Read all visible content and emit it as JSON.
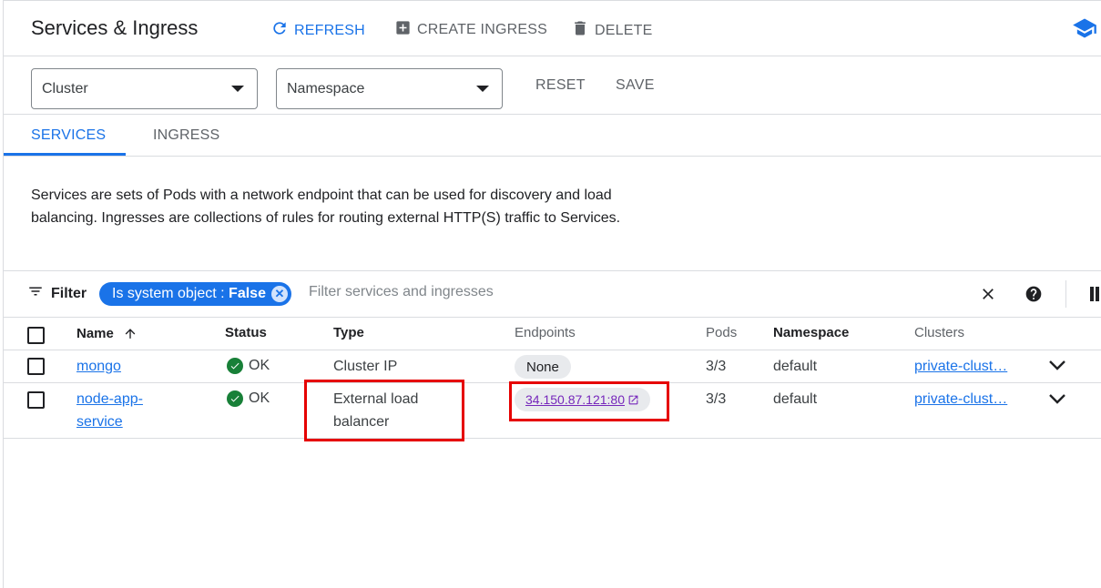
{
  "header": {
    "title": "Services & Ingress",
    "refresh_label": "REFRESH",
    "create_label": "CREATE INGRESS",
    "delete_label": "DELETE",
    "learn_icon": "school-icon"
  },
  "selectors": {
    "cluster": "Cluster",
    "namespace": "Namespace",
    "reset_label": "RESET",
    "save_label": "SAVE"
  },
  "tabs": [
    {
      "label": "SERVICES",
      "active": true
    },
    {
      "label": "INGRESS",
      "active": false
    }
  ],
  "description": "Services are sets of Pods with a network endpoint that can be used for discovery and load balancing. Ingresses are collections of rules for routing external HTTP(S) traffic to Services.",
  "filter": {
    "label": "Filter",
    "chip_key": "Is system object : ",
    "chip_value": "False",
    "placeholder": "Filter services and ingresses"
  },
  "table": {
    "columns": [
      "Name",
      "Status",
      "Type",
      "Endpoints",
      "Pods",
      "Namespace",
      "Clusters"
    ],
    "sort_column": "Name",
    "rows": [
      {
        "name_line1": "mongo",
        "name_line2": "",
        "status": "OK",
        "type_line1": "Cluster IP",
        "type_line2": "",
        "endpoint": "None",
        "pods": "3/3",
        "namespace": "default",
        "cluster": "private-clust…"
      },
      {
        "name_line1": "node-app-",
        "name_line2": "service",
        "status": "OK",
        "type_line1": "External load",
        "type_line2": "balancer",
        "endpoint": "34.150.87.121:80",
        "pods": "3/3",
        "namespace": "default",
        "cluster": "private-clust…"
      }
    ]
  },
  "colors": {
    "accent": "#1a73e8",
    "ok": "#188038",
    "highlight": "#e60000",
    "visited_link": "#7627bb"
  }
}
